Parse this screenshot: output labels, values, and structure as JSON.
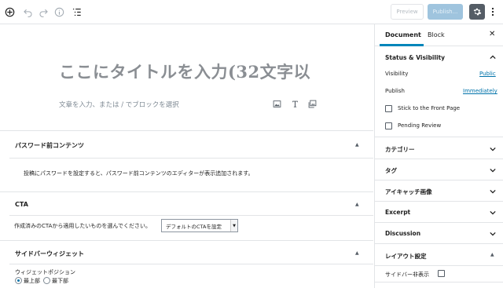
{
  "toolbar": {
    "preview_label": "Preview",
    "publish_label": "Publish..."
  },
  "editor": {
    "title_text": "ここにタイトルを入力(32文字以",
    "appender_text": "文章を入力、または / でブロックを選択"
  },
  "metaboxes": {
    "password": {
      "title": "パスワード前コンテンツ",
      "description": "投稿にパスワードを設定すると、パスワード前コンテンツのエディターが表示追加されます。"
    },
    "cta": {
      "title": "CTA",
      "instruction": "作成済みのCTAから適用したいものを選んでください。",
      "select_value": "デフォルトのCTAを設定"
    },
    "sidebar_widget": {
      "title": "サイドバーウィジェット",
      "position_label": "ウィジェットポジション",
      "option_top": "最上部",
      "option_bottom": "最下部"
    }
  },
  "sidebar": {
    "tab_document": "Document",
    "tab_block": "Block",
    "status_title": "Status & Visibility",
    "visibility_label": "Visibility",
    "visibility_value": "Public",
    "publish_label": "Publish",
    "publish_value": "Immediately",
    "sticky_label": "Stick to the Front Page",
    "pending_label": "Pending Review",
    "panels": {
      "categories": "カテゴリー",
      "tags": "タグ",
      "featured_image": "アイキャッチ画像",
      "excerpt": "Excerpt",
      "discussion": "Discussion",
      "layout": "レイアウト設定"
    },
    "sidebar_hide_label": "サイドバー非表示"
  },
  "colors": {
    "accent": "#0085ba",
    "link": "#0073aa",
    "publish_disabled": "#9fc4de",
    "settings_active": "#555d66"
  }
}
